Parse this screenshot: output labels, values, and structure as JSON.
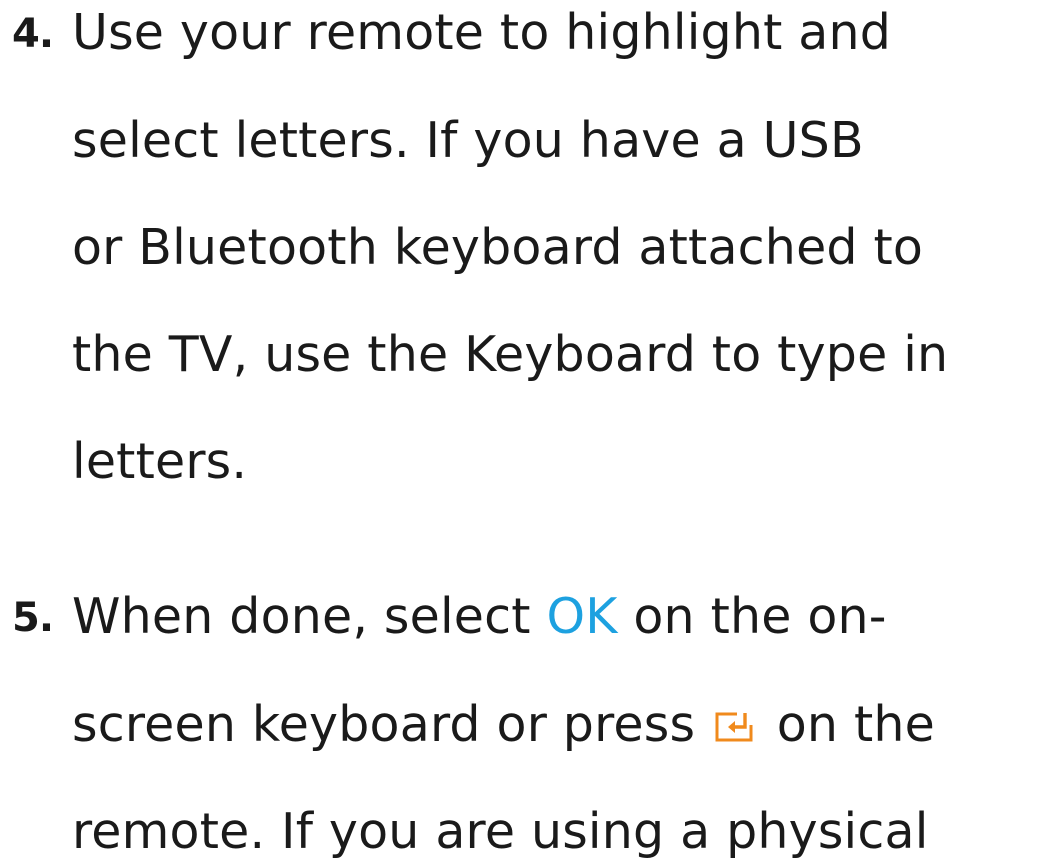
{
  "steps": [
    {
      "number": "4.",
      "lines": [
        "Use your remote to highlight and",
        "select letters. If you have a USB",
        "or Bluetooth keyboard attached to",
        "the TV, use the Keyboard to type in",
        "letters."
      ]
    },
    {
      "number": "5.",
      "line0_before": "When done, select ",
      "line0_accent": "OK",
      "line0_after": " on the on-",
      "line1_before": "screen keyboard or press ",
      "line1_icon": "enter-icon",
      "line1_after": " on the",
      "line2": "remote. If you are using a physical"
    }
  ],
  "colors": {
    "text": "#1a1a1a",
    "accent": "#1da1e0",
    "icon": "#f08a1c"
  }
}
